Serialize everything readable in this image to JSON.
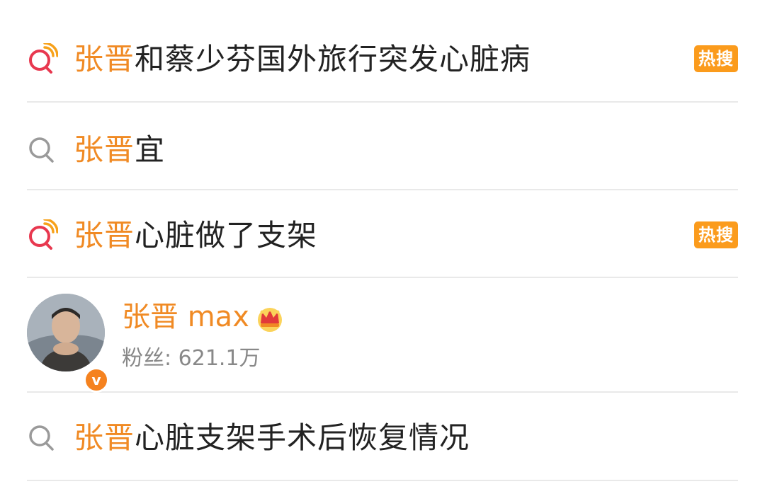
{
  "results": [
    {
      "highlight": "张晋",
      "rest": "和蔡少芬国外旅行突发心脏病",
      "icon": "hot-search-icon",
      "badge": "热搜"
    },
    {
      "highlight": "张晋",
      "rest": "宜",
      "icon": "search-icon"
    },
    {
      "highlight": "张晋",
      "rest": "心脏做了支架",
      "icon": "hot-search-icon",
      "badge": "热搜"
    },
    {
      "highlight": "张晋",
      "rest": "心脏支架手术后恢复情况",
      "icon": "search-icon"
    }
  ],
  "user": {
    "name": "张晋 max",
    "fans_label": "粉丝: ",
    "fans_count": "621.1万",
    "verified_mark": "v",
    "crown_icon": "vip-crown-icon"
  },
  "colors": {
    "highlight": "#f08a24",
    "badge_bg": "#fb9b1c",
    "hot_icon_red": "#e8384f",
    "hot_icon_orange": "#f7a11a",
    "divider": "#e9e9e9"
  }
}
